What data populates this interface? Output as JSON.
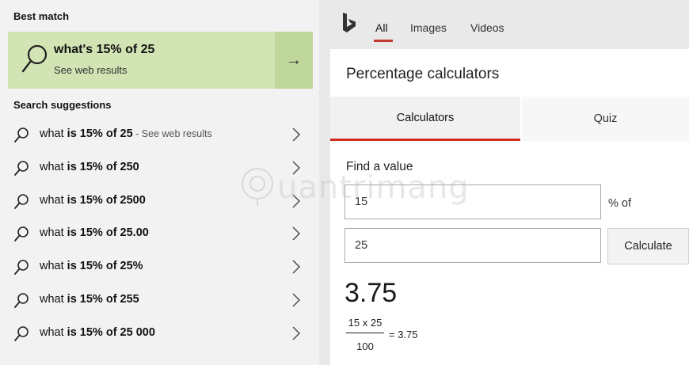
{
  "left": {
    "best_match_label": "Best match",
    "best_match": {
      "title": "what's 15% of 25",
      "subtitle": "See web results",
      "arrow": "→"
    },
    "suggestions_label": "Search suggestions",
    "suggestions": [
      {
        "prefix": "what ",
        "bold": "is 15% of 25",
        "suffix": " - See web results"
      },
      {
        "prefix": "what ",
        "bold": "is 15% of 250",
        "suffix": ""
      },
      {
        "prefix": "what ",
        "bold": "is 15% of 2500",
        "suffix": ""
      },
      {
        "prefix": "what ",
        "bold": "is 15% of 25.00",
        "suffix": ""
      },
      {
        "prefix": "what ",
        "bold": "is 15% of 25%",
        "suffix": ""
      },
      {
        "prefix": "what ",
        "bold": "is 15% of 255",
        "suffix": ""
      },
      {
        "prefix": "what ",
        "bold": "is 15% of 25 000",
        "suffix": ""
      }
    ]
  },
  "right": {
    "tabs": [
      "All",
      "Images",
      "Videos"
    ],
    "card_title": "Percentage calculators",
    "calc_tabs": [
      "Calculators",
      "Quiz"
    ],
    "find_label": "Find a value",
    "value_field": "15",
    "percent_of": "% of",
    "of_field": "25",
    "calculate_button": "Calculate",
    "result": "3.75",
    "fraction": {
      "numerator": "15 x 25",
      "denominator": "100",
      "equals": "= 3.75"
    }
  },
  "watermark": "uantrimang",
  "colors": {
    "best_match_bg": "#d2e3b4",
    "arrow_btn_bg": "#bfd69c",
    "accent_red": "#d42a1c"
  }
}
